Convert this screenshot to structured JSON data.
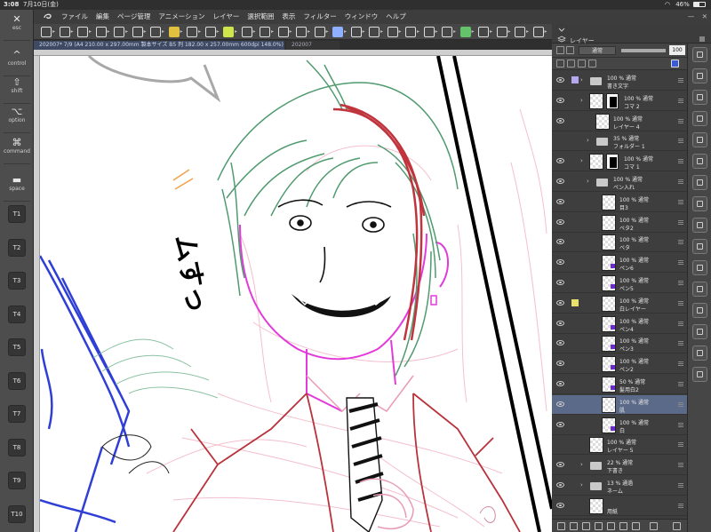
{
  "status_bar": {
    "time": "3:08",
    "date": "7月10日(金)",
    "battery": "46%",
    "battery_level": 0.46
  },
  "edge_keys": [
    {
      "glyph": "✕",
      "label": "esc",
      "name": "esc-key"
    },
    {
      "glyph": "^",
      "label": "control",
      "name": "control-key"
    },
    {
      "glyph": "⇧",
      "label": "shift",
      "name": "shift-key"
    },
    {
      "glyph": "⌥",
      "label": "option",
      "name": "option-key"
    },
    {
      "glyph": "⌘",
      "label": "command",
      "name": "command-key"
    },
    {
      "glyph": "▬",
      "label": "space",
      "name": "space-key"
    }
  ],
  "t_keys": [
    "T1",
    "T2",
    "T3",
    "T4",
    "T5",
    "T6",
    "T7",
    "T8",
    "T9",
    "T10"
  ],
  "menu": {
    "items": [
      "ファイル",
      "編集",
      "ページ管理",
      "アニメーション",
      "レイヤー",
      "選択範囲",
      "表示",
      "フィルター",
      "ウィンドウ",
      "ヘルプ"
    ]
  },
  "panel_header": {
    "title": "レイヤー",
    "blend_mode": "通常",
    "opacity": "100"
  },
  "doc_tabs": {
    "active": "202007* 7/9 (A4 210.00 x 297.00mm 製本サイズ B5 判 182.00 x 257.00mm 600dpi 148.0%)",
    "inactive": "202007"
  },
  "canvas_text": {
    "sfx": "ムすっ"
  },
  "layers": [
    {
      "name": "書き文字",
      "props": "100 % 通常",
      "type": "folder",
      "indent": 0,
      "eye": true,
      "lockcolor": "#b5a8f0",
      "name_key": "kakimoji"
    },
    {
      "name": "コマ 2",
      "props": "100 % 通常",
      "type": "frame",
      "indent": 0,
      "eye": true,
      "name_key": "koma2"
    },
    {
      "name": "レイヤー 4",
      "props": "100 % 通常",
      "type": "raster",
      "indent": 1,
      "eye": true,
      "name_key": "layer4"
    },
    {
      "name": "フォルダー 1",
      "props": "35 % 通常",
      "type": "folder",
      "indent": 1,
      "eye": false,
      "name_key": "folder1"
    },
    {
      "name": "コマ 1",
      "props": "100 % 通常",
      "type": "frame",
      "indent": 0,
      "eye": true,
      "name_key": "koma1"
    },
    {
      "name": "ペン入れ",
      "props": "100 % 通常",
      "type": "folder",
      "indent": 1,
      "eye": true,
      "name_key": "penire"
    },
    {
      "name": "目3",
      "props": "100 % 通常",
      "type": "raster",
      "indent": 2,
      "eye": true,
      "name_key": "me3"
    },
    {
      "name": "ベタ2",
      "props": "100 % 通常",
      "type": "raster",
      "indent": 2,
      "eye": true,
      "name_key": "beta2"
    },
    {
      "name": "ベタ",
      "props": "100 % 通常",
      "type": "raster",
      "indent": 2,
      "eye": true,
      "name_key": "beta"
    },
    {
      "name": "ペン6",
      "props": "100 % 通常",
      "type": "raster",
      "indent": 2,
      "eye": true,
      "mark": true,
      "name_key": "pen6"
    },
    {
      "name": "ペン5",
      "props": "100 % 通常",
      "type": "raster",
      "indent": 2,
      "eye": true,
      "mark": true,
      "name_key": "pen5"
    },
    {
      "name": "白レイヤー",
      "props": "100 % 通常",
      "type": "raster",
      "indent": 2,
      "eye": true,
      "lockcolor": "#e8e26a",
      "name_key": "shiro-layer"
    },
    {
      "name": "ペン4",
      "props": "100 % 通常",
      "type": "raster",
      "indent": 2,
      "eye": true,
      "mark": true,
      "name_key": "pen4"
    },
    {
      "name": "ペン3",
      "props": "100 % 通常",
      "type": "raster",
      "indent": 2,
      "eye": true,
      "mark": true,
      "name_key": "pen3"
    },
    {
      "name": "ペン2",
      "props": "100 % 通常",
      "type": "raster",
      "indent": 2,
      "eye": true,
      "mark": true,
      "name_key": "pen2"
    },
    {
      "name": "髪用白2",
      "props": "50 % 通常",
      "type": "raster",
      "indent": 2,
      "eye": true,
      "mark": true,
      "name_key": "kami-shiro2"
    },
    {
      "name": "肌",
      "props": "100 % 通常",
      "type": "raster",
      "indent": 2,
      "eye": true,
      "selected": true,
      "name_key": "hada"
    },
    {
      "name": "白",
      "props": "100 % 通常",
      "type": "raster",
      "indent": 2,
      "eye": true,
      "mark": true,
      "name_key": "shiro"
    },
    {
      "name": "レイヤー 5",
      "props": "100 % 通常",
      "type": "raster",
      "indent": 0,
      "eye": false,
      "name_key": "layer5"
    },
    {
      "name": "下書き",
      "props": "22 % 通常",
      "type": "folder",
      "indent": 0,
      "eye": true,
      "name_key": "shitagaki"
    },
    {
      "name": "ネーム",
      "props": "13 % 通過",
      "type": "folder",
      "indent": 0,
      "eye": true,
      "name_key": "name"
    },
    {
      "name": "用紙",
      "props": "",
      "type": "paper",
      "indent": 0,
      "eye": true,
      "name_key": "youshi"
    }
  ],
  "colors": {
    "hair_green": "#4f9a6e",
    "hair_red": "#c0343d",
    "skin_magenta": "#e23bd9",
    "blue_line": "#2f3fd6",
    "suit_red": "#b8333b",
    "pink_sketch": "#f3b8c8",
    "selection_blue": "#5b6a88"
  }
}
